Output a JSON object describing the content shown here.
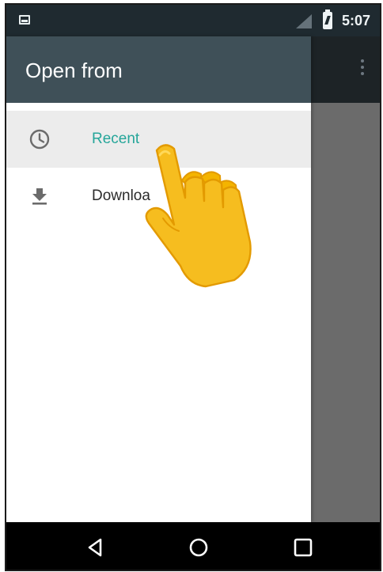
{
  "status_bar": {
    "time": "5:07",
    "icons": [
      "notification-image-icon",
      "signal-icon",
      "battery-charging-icon"
    ]
  },
  "drawer": {
    "title": "Open from",
    "items": [
      {
        "label": "Recent",
        "icon": "clock-icon",
        "selected": true
      },
      {
        "label": "Downloa",
        "icon": "download-icon",
        "selected": false
      }
    ]
  },
  "background_app": {
    "icons": [
      "overflow-menu-icon"
    ]
  },
  "nav_bar": {
    "icons": [
      "back-icon",
      "home-icon",
      "recents-icon"
    ]
  },
  "overlay": {
    "icon": "pointing-hand-icon"
  },
  "colors": {
    "status_bar": "#1f2a30",
    "drawer_header": "#3f5058",
    "accent": "#26a69a",
    "selected_row": "#ececec",
    "scrim": "#6b6b6b",
    "nav_bar": "#000000"
  }
}
